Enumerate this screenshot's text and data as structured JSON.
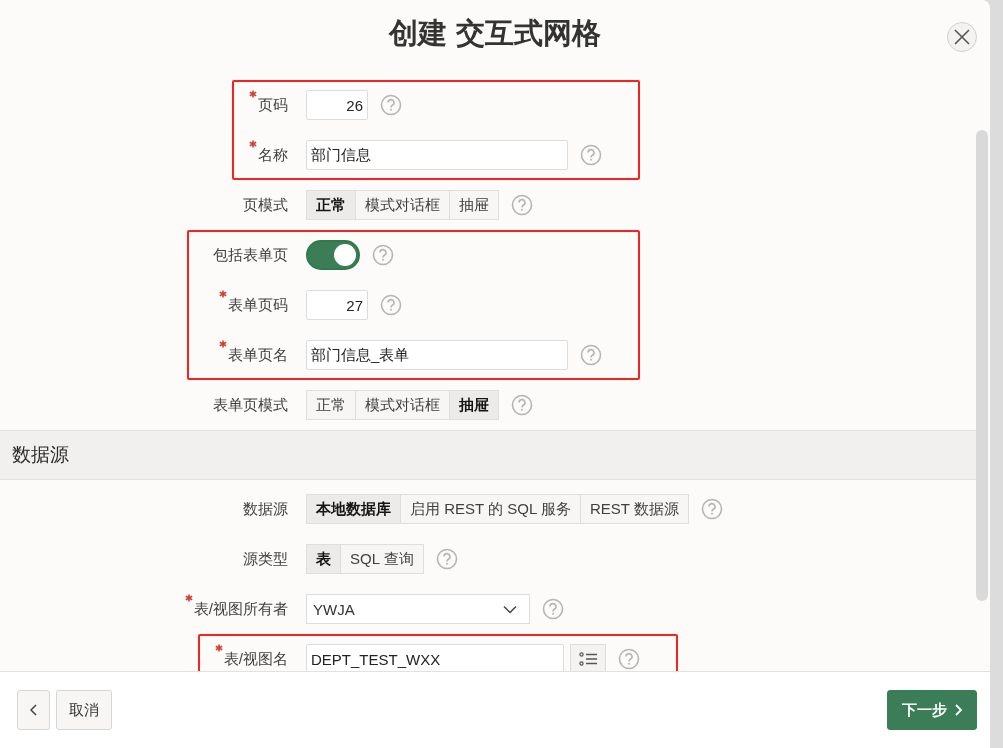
{
  "dialog": {
    "title": "创建 交互式网格"
  },
  "sections": [
    {
      "groups": [
        {
          "annotated": true,
          "fields": [
            {
              "kind": "number",
              "label": "页码",
              "required": true,
              "value": "26"
            },
            {
              "kind": "text",
              "label": "名称",
              "required": true,
              "value": "部门信息"
            }
          ]
        },
        {
          "annotated": false,
          "fields": [
            {
              "kind": "segmented",
              "label": "页模式",
              "required": false,
              "options": [
                {
                  "label": "正常",
                  "selected": true
                },
                {
                  "label": "模式对话框",
                  "selected": false
                },
                {
                  "label": "抽屉",
                  "selected": false
                }
              ]
            }
          ]
        },
        {
          "annotated": true,
          "fields": [
            {
              "kind": "switch",
              "label": "包括表单页",
              "required": false,
              "on": true
            },
            {
              "kind": "number",
              "label": "表单页码",
              "required": true,
              "value": "27"
            },
            {
              "kind": "text",
              "label": "表单页名",
              "required": true,
              "value": "部门信息_表单"
            }
          ]
        },
        {
          "annotated": false,
          "fields": [
            {
              "kind": "segmented",
              "label": "表单页模式",
              "required": false,
              "options": [
                {
                  "label": "正常",
                  "selected": false
                },
                {
                  "label": "模式对话框",
                  "selected": false
                },
                {
                  "label": "抽屉",
                  "selected": true
                }
              ]
            }
          ]
        }
      ]
    },
    {
      "heading": "数据源",
      "groups": [
        {
          "annotated": false,
          "fields": [
            {
              "kind": "segmented",
              "label": "数据源",
              "required": false,
              "options": [
                {
                  "label": "本地数据库",
                  "selected": true
                },
                {
                  "label": "启用 REST 的 SQL 服务",
                  "selected": false
                },
                {
                  "label": "REST 数据源",
                  "selected": false
                }
              ]
            },
            {
              "kind": "segmented",
              "label": "源类型",
              "required": false,
              "options": [
                {
                  "label": "表",
                  "selected": true
                },
                {
                  "label": "SQL 查询",
                  "selected": false
                }
              ]
            },
            {
              "kind": "select",
              "label": "表/视图所有者",
              "required": true,
              "value": "YWJA"
            }
          ]
        },
        {
          "annotated": true,
          "fields": [
            {
              "kind": "popup",
              "label": "表/视图名",
              "required": true,
              "value": "DEPT_TEST_WXX"
            }
          ]
        }
      ]
    }
  ],
  "footer": {
    "cancel": "取消",
    "next": "下一步"
  }
}
